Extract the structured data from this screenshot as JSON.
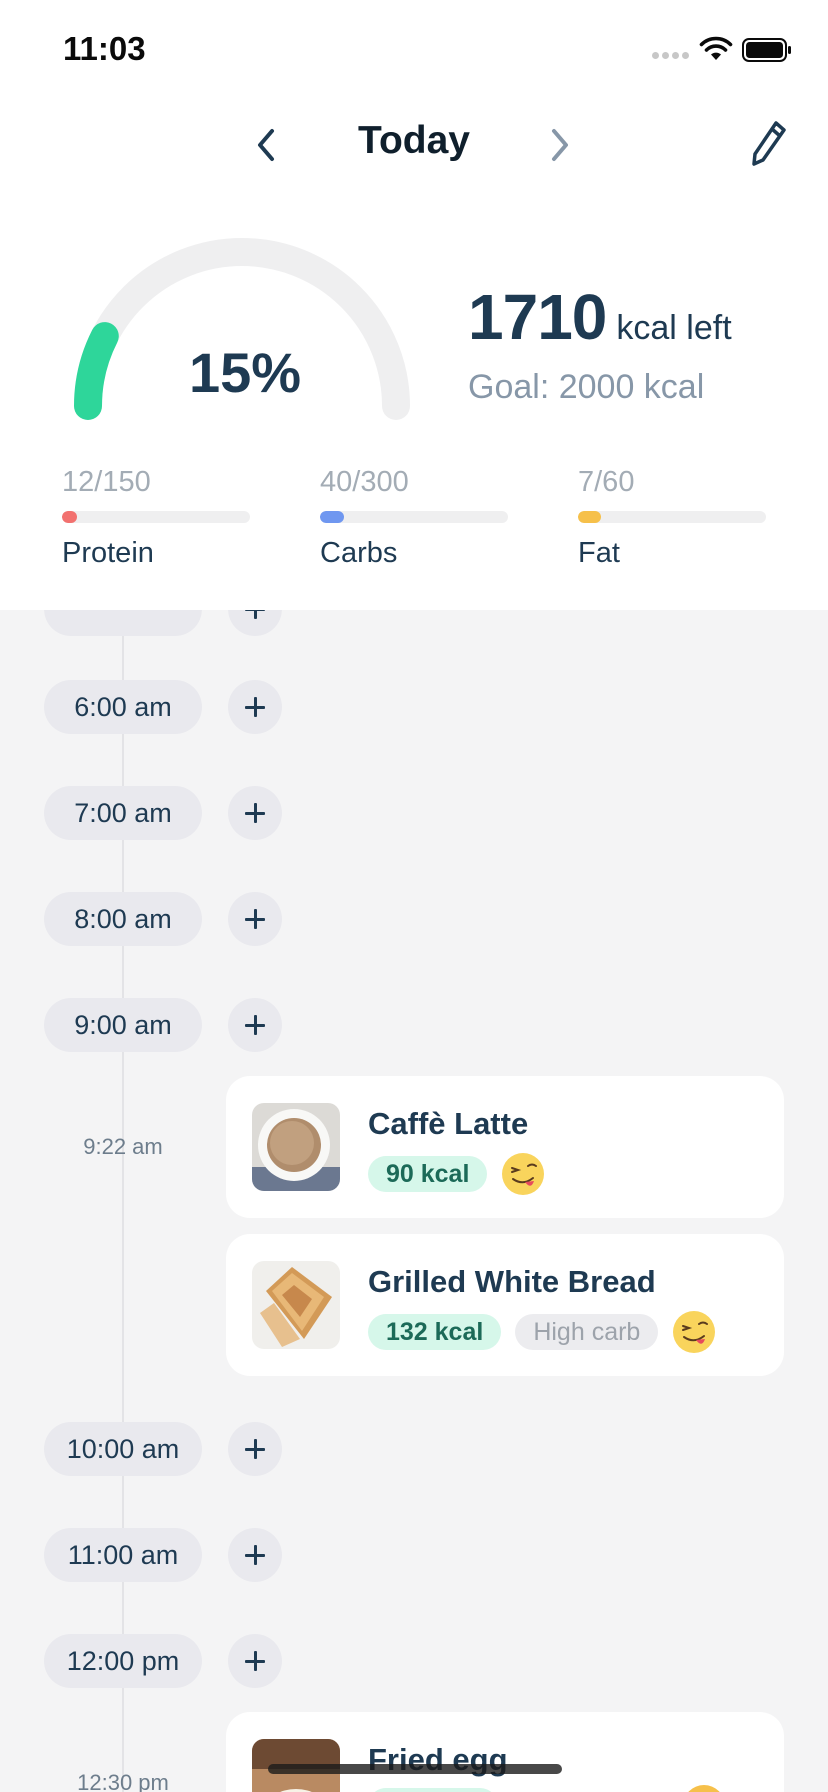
{
  "status_bar": {
    "time": "11:03"
  },
  "nav": {
    "title": "Today",
    "prev_icon": "chevron-left-icon",
    "next_icon": "chevron-right-icon",
    "edit_icon": "pencil-icon"
  },
  "summary": {
    "percent_label": "15%",
    "progress_fraction": 0.15,
    "kcal_left": "1710",
    "kcal_left_label": "kcal left",
    "goal_label": "Goal: 2000 kcal",
    "gauge_color": "#2ed69a",
    "track_color": "#efeff0"
  },
  "macros": [
    {
      "value": "12/150",
      "name": "Protein",
      "fraction": 0.08,
      "color": "#f2716f"
    },
    {
      "value": "40/300",
      "name": "Carbs",
      "fraction": 0.13,
      "color": "#6f97f0"
    },
    {
      "value": "7/60",
      "name": "Fat",
      "fraction": 0.12,
      "color": "#f6c04a"
    }
  ],
  "timeline": {
    "slots": [
      "6:00 am",
      "7:00 am",
      "8:00 am",
      "9:00 am",
      "10:00 am",
      "11:00 am",
      "12:00 pm"
    ],
    "entries": [
      {
        "time": "9:22 am",
        "items": [
          {
            "name": "Caffè Latte",
            "kcal": "90 kcal",
            "tags": [],
            "mood_icon": "yummy-face-emoji-icon"
          },
          {
            "name": "Grilled White Bread",
            "kcal": "132 kcal",
            "tags": [
              "High carb"
            ],
            "mood_icon": "yummy-face-emoji-icon"
          }
        ]
      },
      {
        "time": "12:30 pm",
        "items": [
          {
            "name": "Fried egg",
            "kcal": "",
            "tags": [],
            "mood_icon": "emoji-icon"
          }
        ]
      }
    ]
  }
}
